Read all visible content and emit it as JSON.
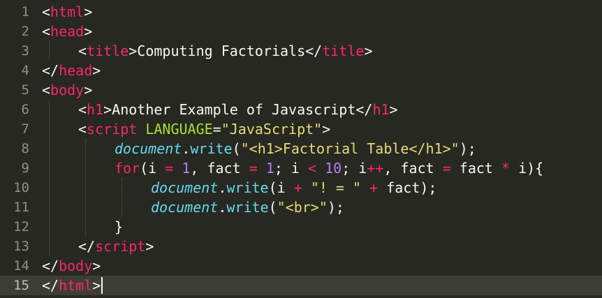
{
  "editor": {
    "active_line": 15,
    "theme_colors": {
      "background": "#272822",
      "default_text": "#f8f8f2",
      "tag": "#f92672",
      "attribute": "#a6e22e",
      "string": "#e6db74",
      "number": "#ae81ff",
      "keyword": "#f92672",
      "object": "#66d9ef",
      "function": "#66d9ef",
      "gutter": "#90908a"
    },
    "lines": [
      {
        "n": "1",
        "indent": 0,
        "tokens": [
          {
            "t": "<",
            "c": "p"
          },
          {
            "t": "html",
            "c": "tag"
          },
          {
            "t": ">",
            "c": "p"
          }
        ]
      },
      {
        "n": "2",
        "indent": 0,
        "tokens": [
          {
            "t": "<",
            "c": "p"
          },
          {
            "t": "head",
            "c": "tag"
          },
          {
            "t": ">",
            "c": "p"
          }
        ]
      },
      {
        "n": "3",
        "indent": 1,
        "tokens": [
          {
            "t": "<",
            "c": "p"
          },
          {
            "t": "title",
            "c": "tag"
          },
          {
            "t": ">Computing Factorials</",
            "c": "p"
          },
          {
            "t": "title",
            "c": "tag"
          },
          {
            "t": ">",
            "c": "p"
          }
        ]
      },
      {
        "n": "4",
        "indent": 0,
        "tokens": [
          {
            "t": "</",
            "c": "p"
          },
          {
            "t": "head",
            "c": "tag"
          },
          {
            "t": ">",
            "c": "p"
          }
        ]
      },
      {
        "n": "5",
        "indent": 0,
        "tokens": [
          {
            "t": "<",
            "c": "p"
          },
          {
            "t": "body",
            "c": "tag"
          },
          {
            "t": ">",
            "c": "p"
          }
        ]
      },
      {
        "n": "6",
        "indent": 1,
        "tokens": [
          {
            "t": "<",
            "c": "p"
          },
          {
            "t": "h1",
            "c": "tag"
          },
          {
            "t": ">Another Example of Javascript</",
            "c": "p"
          },
          {
            "t": "h1",
            "c": "tag"
          },
          {
            "t": ">",
            "c": "p"
          }
        ]
      },
      {
        "n": "7",
        "indent": 1,
        "tokens": [
          {
            "t": "<",
            "c": "p"
          },
          {
            "t": "script",
            "c": "tag"
          },
          {
            "t": " ",
            "c": "p"
          },
          {
            "t": "LANGUAGE",
            "c": "attr"
          },
          {
            "t": "=",
            "c": "p"
          },
          {
            "t": "\"JavaScript\"",
            "c": "str"
          },
          {
            "t": ">",
            "c": "p"
          }
        ]
      },
      {
        "n": "8",
        "indent": 2,
        "tokens": [
          {
            "t": "document",
            "c": "obj"
          },
          {
            "t": ".",
            "c": "p"
          },
          {
            "t": "write",
            "c": "fn"
          },
          {
            "t": "(",
            "c": "p"
          },
          {
            "t": "\"<h1>Factorial Table</h1>\"",
            "c": "str"
          },
          {
            "t": ");",
            "c": "p"
          }
        ]
      },
      {
        "n": "9",
        "indent": 2,
        "tokens": [
          {
            "t": "for",
            "c": "kw"
          },
          {
            "t": "(i ",
            "c": "p"
          },
          {
            "t": "=",
            "c": "kw"
          },
          {
            "t": " ",
            "c": "p"
          },
          {
            "t": "1",
            "c": "num"
          },
          {
            "t": ", fact ",
            "c": "p"
          },
          {
            "t": "=",
            "c": "kw"
          },
          {
            "t": " ",
            "c": "p"
          },
          {
            "t": "1",
            "c": "num"
          },
          {
            "t": "; i ",
            "c": "p"
          },
          {
            "t": "<",
            "c": "kw"
          },
          {
            "t": " ",
            "c": "p"
          },
          {
            "t": "10",
            "c": "num"
          },
          {
            "t": "; i",
            "c": "p"
          },
          {
            "t": "++",
            "c": "kw"
          },
          {
            "t": ", fact ",
            "c": "p"
          },
          {
            "t": "=",
            "c": "kw"
          },
          {
            "t": " fact ",
            "c": "p"
          },
          {
            "t": "*",
            "c": "kw"
          },
          {
            "t": " i){",
            "c": "p"
          }
        ]
      },
      {
        "n": "10",
        "indent": 3,
        "tokens": [
          {
            "t": "document",
            "c": "obj"
          },
          {
            "t": ".",
            "c": "p"
          },
          {
            "t": "write",
            "c": "fn"
          },
          {
            "t": "(i ",
            "c": "p"
          },
          {
            "t": "+",
            "c": "kw"
          },
          {
            "t": " ",
            "c": "p"
          },
          {
            "t": "\"! = \"",
            "c": "str"
          },
          {
            "t": " ",
            "c": "p"
          },
          {
            "t": "+",
            "c": "kw"
          },
          {
            "t": " fact);",
            "c": "p"
          }
        ]
      },
      {
        "n": "11",
        "indent": 3,
        "tokens": [
          {
            "t": "document",
            "c": "obj"
          },
          {
            "t": ".",
            "c": "p"
          },
          {
            "t": "write",
            "c": "fn"
          },
          {
            "t": "(",
            "c": "p"
          },
          {
            "t": "\"<br>\"",
            "c": "str"
          },
          {
            "t": ");",
            "c": "p"
          }
        ]
      },
      {
        "n": "12",
        "indent": 2,
        "tokens": [
          {
            "t": "}",
            "c": "p"
          }
        ]
      },
      {
        "n": "13",
        "indent": 1,
        "tokens": [
          {
            "t": "</",
            "c": "p"
          },
          {
            "t": "script",
            "c": "tag"
          },
          {
            "t": ">",
            "c": "p"
          }
        ]
      },
      {
        "n": "14",
        "indent": 0,
        "tokens": [
          {
            "t": "</",
            "c": "p"
          },
          {
            "t": "body",
            "c": "tag"
          },
          {
            "t": ">",
            "c": "p"
          }
        ]
      },
      {
        "n": "15",
        "indent": 0,
        "tokens": [
          {
            "t": "</",
            "c": "p"
          },
          {
            "t": "html",
            "c": "tag"
          },
          {
            "t": ">",
            "c": "p"
          }
        ]
      }
    ]
  }
}
